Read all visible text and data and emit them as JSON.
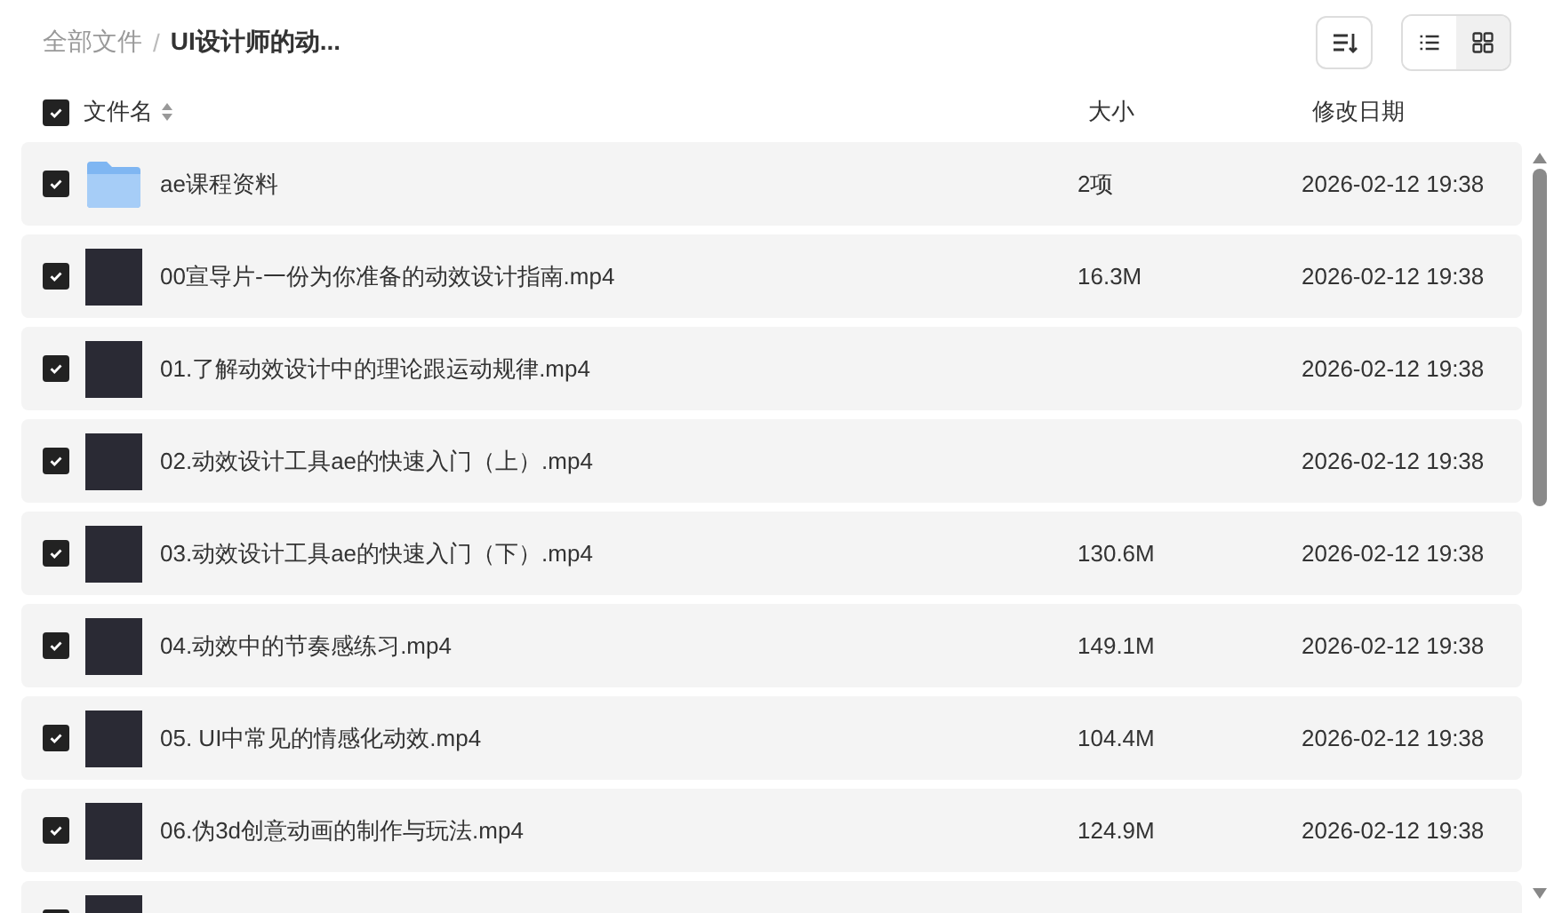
{
  "breadcrumb": [
    {
      "label": "全部文件",
      "current": false
    },
    {
      "label": "UI设计师的动...",
      "current": true
    }
  ],
  "breadcrumb_separator": "/",
  "toolbar": {
    "views": [
      {
        "kind": "list",
        "selected": true
      },
      {
        "kind": "grid",
        "selected": false
      }
    ]
  },
  "header": {
    "select_all_checked": true,
    "columns": [
      "文件名",
      "大小",
      "修改日期"
    ]
  },
  "rows": [
    {
      "kind": "folder",
      "checked": true,
      "name": "ae课程资料",
      "size": "2项",
      "date": "2026-02-12 19:38"
    },
    {
      "kind": "video",
      "checked": true,
      "name": "00宣导片-一份为你准备的动效设计指南.mp4",
      "size": "16.3M",
      "date": "2026-02-12 19:38"
    },
    {
      "kind": "video",
      "checked": true,
      "name": "01.了解动效设计中的理论跟运动规律.mp4",
      "date": "2026-02-12 19:38"
    },
    {
      "kind": "video",
      "checked": true,
      "name": "02.动效设计工具ae的快速入门（上）.mp4",
      "date": "2026-02-12 19:38"
    },
    {
      "kind": "video",
      "checked": true,
      "name": "03.动效设计工具ae的快速入门（下）.mp4",
      "size": "130.6M",
      "date": "2026-02-12 19:38"
    },
    {
      "kind": "video",
      "checked": true,
      "name": "04.动效中的节奏感练习.mp4",
      "size": "149.1M",
      "date": "2026-02-12 19:38"
    },
    {
      "kind": "video",
      "checked": true,
      "name": "05. UI中常见的情感化动效.mp4",
      "size": "104.4M",
      "date": "2026-02-12 19:38"
    },
    {
      "kind": "video",
      "checked": true,
      "name": "06.伪3d创意动画的制作与玩法.mp4",
      "size": "124.9M",
      "date": "2026-02-12 19:38"
    },
    {
      "kind": "video",
      "checked": true
    }
  ]
}
